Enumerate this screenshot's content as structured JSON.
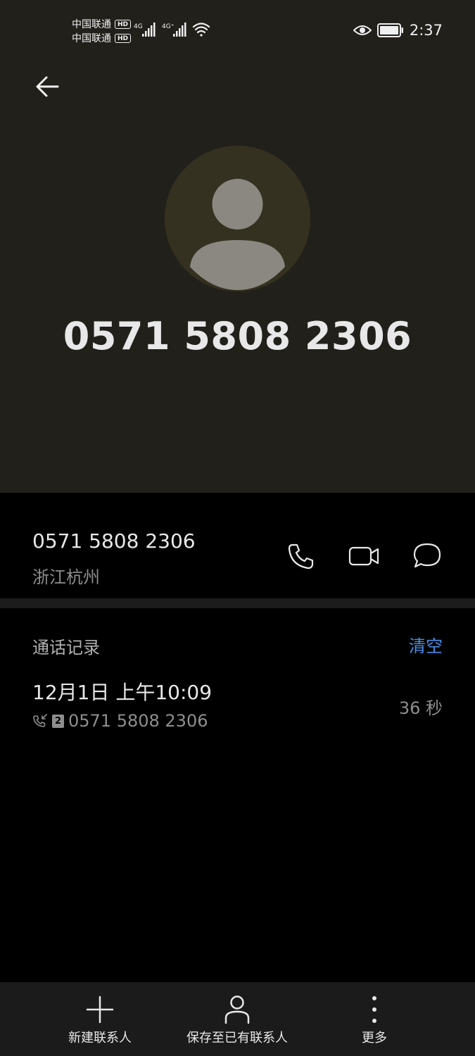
{
  "status_bar": {
    "carrier_1": "中国联通",
    "carrier_2": "中国联通",
    "hd_1": "HD",
    "hd_2": "HD",
    "network_1": "4G",
    "network_2": "4G⁺",
    "time": "2:37"
  },
  "contact": {
    "headline_number": "0571 5808 2306",
    "number": "0571 5808 2306",
    "location": "浙江杭州"
  },
  "call_log": {
    "title": "通话记录",
    "clear_label": "清空",
    "entries": [
      {
        "datetime": "12月1日 上午10:09",
        "sim": "2",
        "number": "0571 5808 2306",
        "duration": "36 秒"
      }
    ]
  },
  "bottom_bar": {
    "new_contact": "新建联系人",
    "save_existing": "保存至已有联系人",
    "more": "更多"
  },
  "icons": {
    "back": "arrow-left-icon",
    "call": "phone-icon",
    "video": "video-camera-icon",
    "message": "chat-bubble-icon",
    "add": "plus-icon",
    "person": "person-icon",
    "more": "more-vertical-icon"
  },
  "colors": {
    "header_bg": "#22201a",
    "avatar_bg": "#343121",
    "accent": "#4a8fe7",
    "bottom_bar_bg": "#1b1b1b"
  }
}
